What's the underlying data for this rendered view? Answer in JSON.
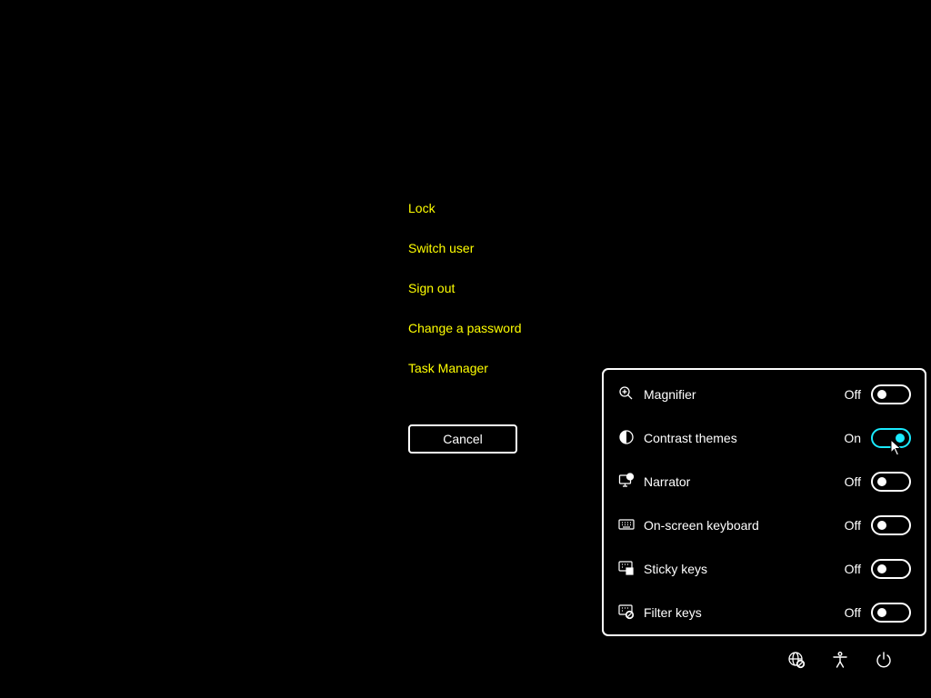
{
  "options_menu": {
    "items": [
      {
        "label": "Lock"
      },
      {
        "label": "Switch user"
      },
      {
        "label": "Sign out"
      },
      {
        "label": "Change a password"
      },
      {
        "label": "Task Manager"
      }
    ],
    "cancel_label": "Cancel"
  },
  "accessibility_panel": {
    "rows": [
      {
        "label": "Magnifier",
        "state": "Off",
        "on": false,
        "icon": "magnifier-icon"
      },
      {
        "label": "Contrast themes",
        "state": "On",
        "on": true,
        "icon": "contrast-icon"
      },
      {
        "label": "Narrator",
        "state": "Off",
        "on": false,
        "icon": "narrator-icon"
      },
      {
        "label": "On-screen keyboard",
        "state": "Off",
        "on": false,
        "icon": "keyboard-icon"
      },
      {
        "label": "Sticky keys",
        "state": "Off",
        "on": false,
        "icon": "sticky-keys-icon"
      },
      {
        "label": "Filter keys",
        "state": "Off",
        "on": false,
        "icon": "filter-keys-icon"
      }
    ]
  },
  "tray": {
    "icons": [
      "network-icon",
      "accessibility-icon",
      "power-icon"
    ]
  },
  "colors": {
    "background": "#000000",
    "link": "#ffff00",
    "text": "#ffffff",
    "toggle_on": "#1aebff"
  }
}
